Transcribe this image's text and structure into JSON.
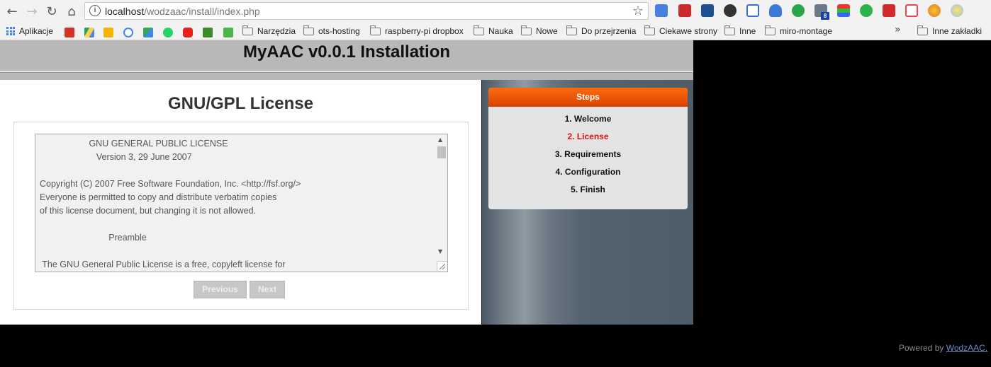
{
  "browser": {
    "url_host": "localhost",
    "url_path": "/wodzaac/install/index.php",
    "bookmarks": [
      "Aplikacje",
      "Narzędzia",
      "ots-hosting",
      "raspberry-pi dropbox",
      "Nauka",
      "Nowe",
      "Do przejrzenia",
      "Ciekawe strony",
      "Inne",
      "miro-montage"
    ],
    "other_bookmarks": "Inne zakładki",
    "ext_badge": "8"
  },
  "header": {
    "title": "MyAAC v0.0.1 Installation"
  },
  "main": {
    "heading": "GNU/GPL License",
    "license_text": "                    GNU GENERAL PUBLIC LICENSE\n                       Version 3, 29 June 2007\n\nCopyright (C) 2007 Free Software Foundation, Inc. <http://fsf.org/>\nEveryone is permitted to copy and distribute verbatim copies\nof this license document, but changing it is not allowed.\n\n                            Preamble\n\n The GNU General Public License is a free, copyleft license for",
    "previous_label": "Previous",
    "next_label": "Next"
  },
  "sidebar": {
    "title": "Steps",
    "steps": [
      "1. Welcome",
      "2. License",
      "3. Requirements",
      "4. Configuration",
      "5. Finish"
    ],
    "active_index": 1
  },
  "footer": {
    "powered_by": "Powered by",
    "link": "WodzAAC."
  },
  "colors": {
    "accent": "#e35a00",
    "active_step": "#d81010"
  }
}
